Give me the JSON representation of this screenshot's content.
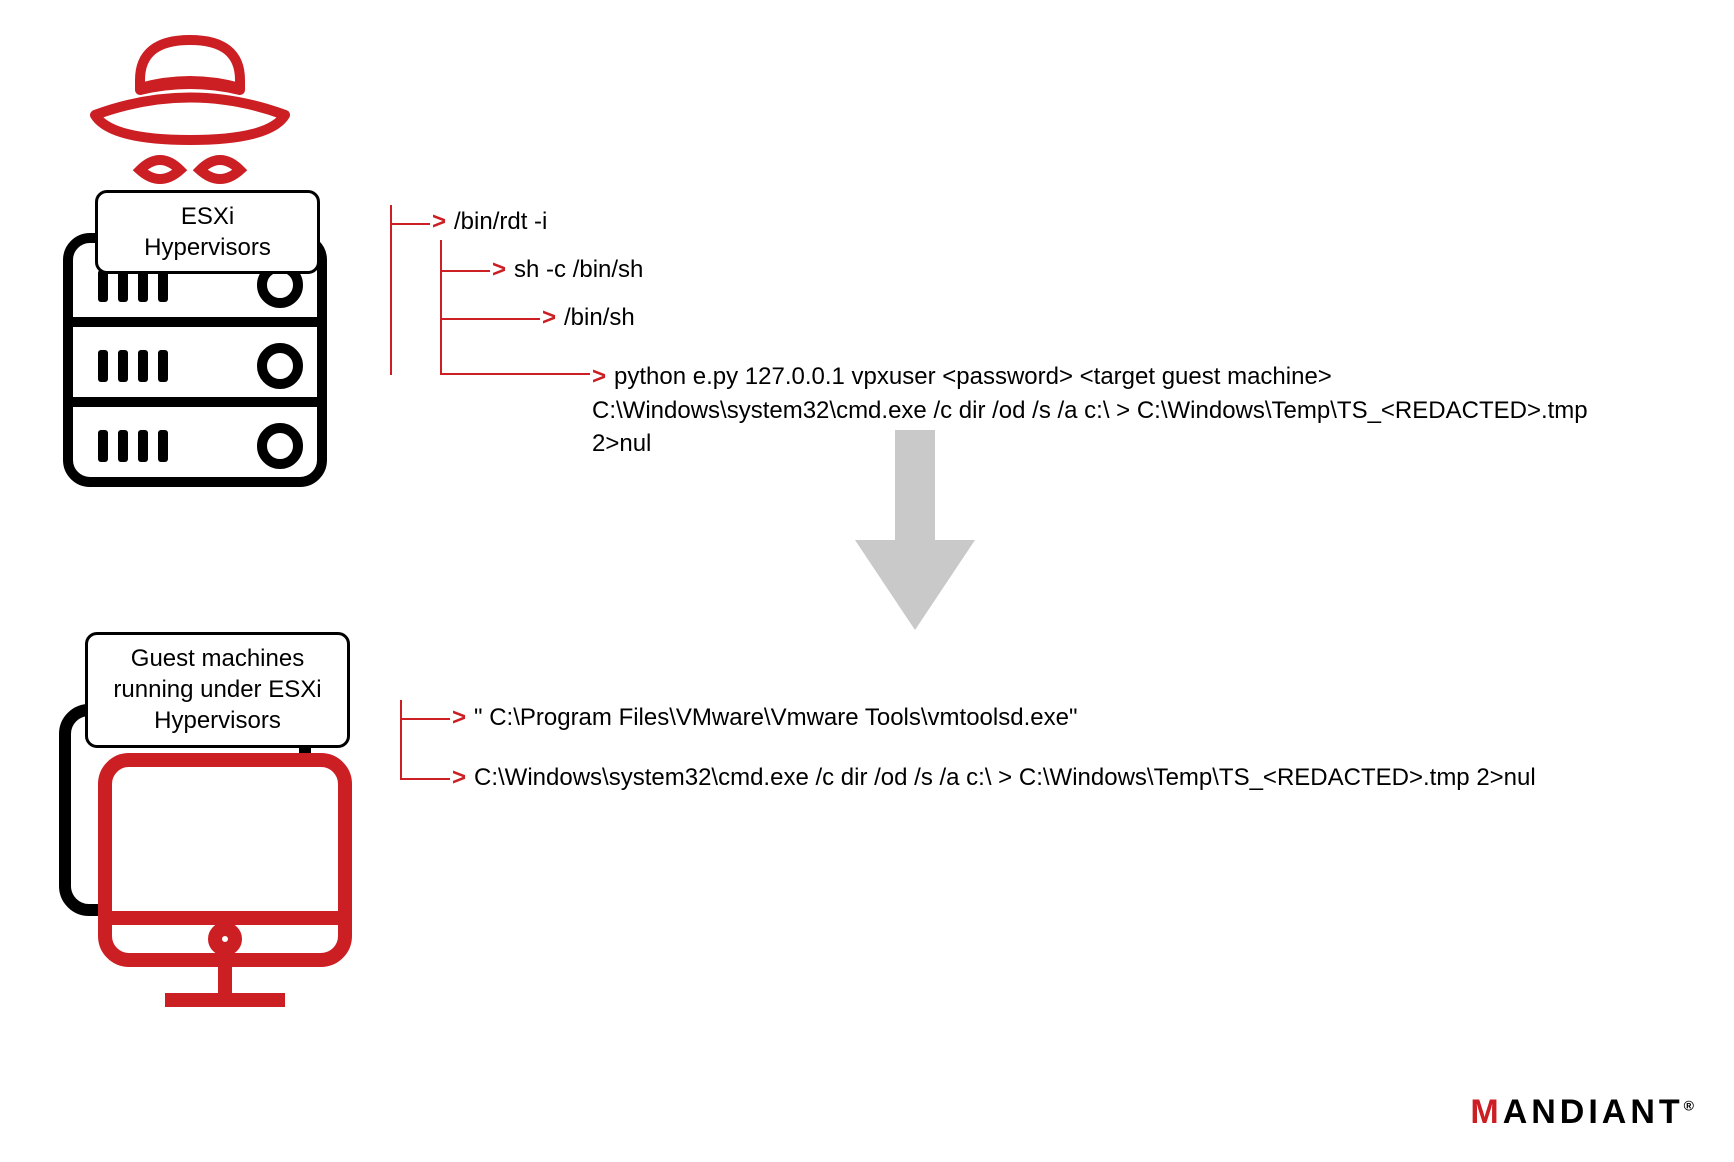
{
  "top": {
    "label": "ESXi Hypervisors",
    "commands": [
      "/bin/rdt -i",
      "sh -c /bin/sh",
      "/bin/sh",
      "python e.py 127.0.0.1 vpxuser <password> <target guest machine> C:\\Windows\\system32\\cmd.exe /c dir /od /s /a c:\\ > C:\\Windows\\Temp\\TS_<REDACTED>.tmp 2>nul"
    ]
  },
  "bottom": {
    "label": "Guest machines running under ESXi Hypervisors",
    "commands": [
      "\" C:\\Program Files\\VMware\\Vmware Tools\\vmtoolsd.exe\"",
      "C:\\Windows\\system32\\cmd.exe /c dir /od /s /a c:\\ > C:\\Windows\\Temp\\TS_<REDACTED>.tmp 2>nul"
    ]
  },
  "brand": "MANDIANT"
}
